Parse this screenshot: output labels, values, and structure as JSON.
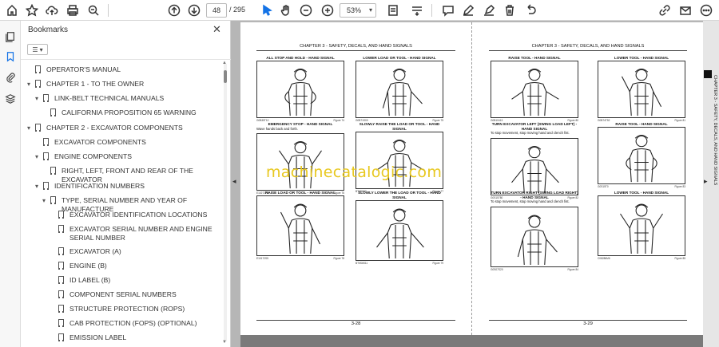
{
  "toolbar": {
    "current_page": "48",
    "total_pages": "/ 295",
    "zoom": "53%"
  },
  "panel": {
    "title": "Bookmarks",
    "items": [
      {
        "label": "OPERATOR'S MANUAL",
        "caret": ""
      },
      {
        "label": "CHAPTER 1 - TO THE OWNER",
        "caret": "▾"
      },
      {
        "label": "LINK-BELT TECHNICAL MANUALS",
        "caret": "▾"
      },
      {
        "label": "CALIFORNIA PROPOSITION 65 WARNING",
        "caret": ""
      },
      {
        "label": "CHAPTER 2 - EXCAVATOR COMPONENTS",
        "caret": "▾"
      },
      {
        "label": "EXCAVATOR COMPONENTS",
        "caret": ""
      },
      {
        "label": "ENGINE COMPONENTS",
        "caret": "▾"
      },
      {
        "label": "RIGHT, LEFT, FRONT AND REAR OF THE EXCAVATOR",
        "caret": ""
      },
      {
        "label": "IDENTIFICATION NUMBERS",
        "caret": "▾"
      },
      {
        "label": "TYPE, SERIAL NUMBER AND YEAR OF MANUFACTURE",
        "caret": "▾"
      },
      {
        "label": "EXCAVATOR IDENTIFICATION LOCATIONS",
        "caret": ""
      },
      {
        "label": "EXCAVATOR SERIAL NUMBER AND ENGINE SERIAL NUMBER",
        "caret": ""
      },
      {
        "label": "EXCAVATOR (A)",
        "caret": ""
      },
      {
        "label": "ENGINE (B)",
        "caret": ""
      },
      {
        "label": "ID LABEL (B)",
        "caret": ""
      },
      {
        "label": "COMPONENT SERIAL NUMBERS",
        "caret": ""
      },
      {
        "label": "STRUCTURE PROTECTION (ROPS)",
        "caret": ""
      },
      {
        "label": "CAB PROTECTION (FOPS) (OPTIONAL)",
        "caret": ""
      },
      {
        "label": "EMISSION LABEL",
        "caret": ""
      }
    ]
  },
  "document": {
    "left_header": "CHAPTER 3 - SAFETY, DECALS, AND HAND SIGNALS",
    "right_header": "CHAPTER 3 - SAFETY, DECALS, AND HAND SIGNALS",
    "left_page_number": "3-28",
    "right_page_number": "3-29",
    "side_tab": "CHAPTER 3 - SAFETY, DECALS, AND HAND SIGNALS",
    "watermark": "machinecatalogic.com",
    "left_signals": [
      {
        "title": "ALL STOP AND HOLD - HAND SIGNAL",
        "sub": "",
        "code": "G0B35T10",
        "fig": "Figure 74"
      },
      {
        "title": "LOWER LOAD OR TOOL - HAND SIGNAL",
        "sub": "",
        "code": "G0B71S00",
        "fig": "Figure 75"
      },
      {
        "title": "EMERGENCY STOP - HAND SIGNAL",
        "sub": "Wave hands back and forth.",
        "code": "E10272260",
        "fig": "Figure 76"
      },
      {
        "title": "SLOWLY RAISE THE LOAD OR TOOL - HAND SIGNAL",
        "sub": "",
        "code": "BT5S6S7",
        "fig": "Figure 77"
      },
      {
        "title": "RAISE LOAD OR TOOL - HAND SIGNAL",
        "sub": "",
        "code": "E10172S5",
        "fig": "Figure 78"
      },
      {
        "title": "SLOWLY LOWER THE LOAD OR TOOL - HAND SIGNAL",
        "sub": "",
        "code": "BT5S6S11",
        "fig": "Figure 79"
      }
    ],
    "right_signals": [
      {
        "title": "RAISE TOOL - HAND SIGNAL",
        "sub": "",
        "code": "G0B10413",
        "fig": "Figure 80"
      },
      {
        "title": "LOWER TOOL - HAND SIGNAL",
        "sub": "",
        "code": "G0B74T52",
        "fig": "Figure 81"
      },
      {
        "title": "TURN EXCAVATOR LEFT (SWING LOAD LEFT) - HAND SIGNAL",
        "sub": "To stop movement, stop moving hand and clench fist.",
        "code": "G0S15780",
        "fig": "Figure 82"
      },
      {
        "title": "RAISE TOOL - HAND SIGNAL",
        "sub": "",
        "code": "G0S15T0",
        "fig": "Figure 83"
      },
      {
        "title": "TURN EXCAVATOR RIGHT (SWING LOAD RIGHT) - HAND SIGNAL",
        "sub": "To stop movement, stop moving hand and clench fist.",
        "code": "G0S07S20",
        "fig": "Figure 84"
      },
      {
        "title": "LOWER TOOL - HAND SIGNAL",
        "sub": "",
        "code": "C08286M6",
        "fig": "Figure 85"
      }
    ]
  }
}
